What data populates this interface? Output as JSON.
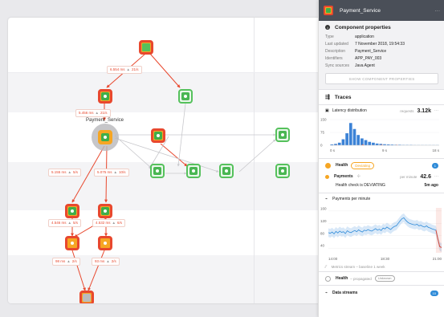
{
  "topology": {
    "focused_node_label": "Payment_Service",
    "edge_labels": [
      {
        "latency": "6.554 ms",
        "rate": "21/s"
      },
      {
        "latency": "5.456 ms",
        "rate": "21/s"
      },
      {
        "latency": "5.155 ms",
        "rate": "5/s"
      },
      {
        "latency": "5.075 ms",
        "rate": "10/s"
      },
      {
        "latency": "4.546 ms",
        "rate": "5/s"
      },
      {
        "latency": "4.532 ms",
        "rate": "6/s"
      },
      {
        "latency": "98 ms",
        "rate": "2/s"
      },
      {
        "latency": "93 ms",
        "rate": "2/s"
      }
    ],
    "status_colors": {
      "critical": "#e8482e",
      "deviating": "#f6a623",
      "healthy": "#55c15c",
      "clear": "#3fae49"
    }
  },
  "panel": {
    "title": "Payment_Service",
    "more_label": "···",
    "component_properties": {
      "title": "Component properties",
      "rows": [
        {
          "key": "Type",
          "value": "application"
        },
        {
          "key": "Last updated",
          "value": "7 November 2018, 19:54:33"
        },
        {
          "key": "Description",
          "value": "Payment_Service"
        },
        {
          "key": "Identifiers",
          "value": "APP_PAY_003"
        },
        {
          "key": "Sync sources",
          "value": "Java Agent"
        }
      ],
      "show_button": "SHOW COMPONENT PROPERTIES"
    },
    "traces": {
      "title": "Traces",
      "latency_label": "Latency distribution",
      "requests_label": "requests",
      "requests_value": "3.12k",
      "more_label": "···",
      "y_ticks": [
        "150",
        "75",
        "0"
      ],
      "x_ticks": [
        "0 s",
        "9 s",
        "18 s"
      ]
    },
    "health": {
      "title": "Health",
      "state_badge": "Deviating",
      "count": "1",
      "metric_name": "Payments",
      "per_minute_label": "per minute",
      "metric_value": "42.6",
      "more_label": "···",
      "check_text": "Health check is DEVIATING",
      "check_age": "5m ago"
    },
    "payments_chart": {
      "title": "Payments per minute",
      "y_ticks": [
        "160",
        "120",
        "80",
        "40"
      ],
      "x_ticks": [
        "14:00",
        "18:30",
        "21:00"
      ],
      "footer": "Metrics stream – baseline 1 week"
    },
    "health_propagated": {
      "title": "Health",
      "suffix": "– propagated",
      "badge": "Unknown"
    },
    "data_streams": {
      "title": "Data streams",
      "count": "10"
    }
  },
  "chart_data": [
    {
      "type": "bar",
      "title": "Latency distribution",
      "xlabel": "",
      "ylabel": "",
      "x_range": [
        "0 s",
        "18 s"
      ],
      "ylim": [
        0,
        150
      ],
      "categories": [
        "b1",
        "b2",
        "b3",
        "b4",
        "b5",
        "b6",
        "b7",
        "b8",
        "b9",
        "b10",
        "b11",
        "b12",
        "b13",
        "b14",
        "b15",
        "b16",
        "b17",
        "b18",
        "b19",
        "b20",
        "b21",
        "b22",
        "b23",
        "b24",
        "b25",
        "b26",
        "b27",
        "b28",
        "b29"
      ],
      "series": [
        {
          "values": [
            5,
            8,
            15,
            35,
            70,
            130,
            95,
            60,
            40,
            30,
            20,
            15,
            10,
            8,
            6,
            5,
            4,
            3,
            3,
            2,
            2,
            2,
            1,
            1,
            1,
            1,
            1,
            1,
            1
          ],
          "color": "#3b82d6"
        },
        {
          "values": [
            0,
            2,
            0,
            0,
            0,
            0,
            0,
            0,
            4,
            0,
            0,
            0,
            0,
            3,
            0,
            0,
            0,
            2,
            0,
            0,
            0,
            0,
            0,
            0,
            0,
            0,
            0,
            0,
            0
          ],
          "color": "#e8482e"
        }
      ]
    },
    {
      "type": "line",
      "title": "Payments per minute",
      "x_ticks": [
        "14:00",
        "18:30",
        "21:00"
      ],
      "ylim": [
        25,
        170
      ],
      "series": [
        {
          "name": "Payments",
          "values": [
            90,
            88,
            92,
            86,
            94,
            89,
            95,
            91,
            93,
            87,
            96,
            92,
            90,
            94,
            97,
            93,
            99,
            95,
            92,
            98,
            96,
            100,
            97,
            95,
            99,
            103,
            98,
            101,
            97,
            105,
            102,
            108,
            104,
            100,
            106,
            110,
            112,
            120,
            128,
            135,
            138,
            130,
            124,
            120,
            118,
            116,
            115,
            117,
            112,
            114,
            110,
            108,
            112,
            107,
            105,
            102,
            100,
            98,
            70,
            45,
            42
          ],
          "color": "#2f8bd8"
        }
      ],
      "band_color": "#a9cdef",
      "alert_color": "#e8482e"
    }
  ]
}
